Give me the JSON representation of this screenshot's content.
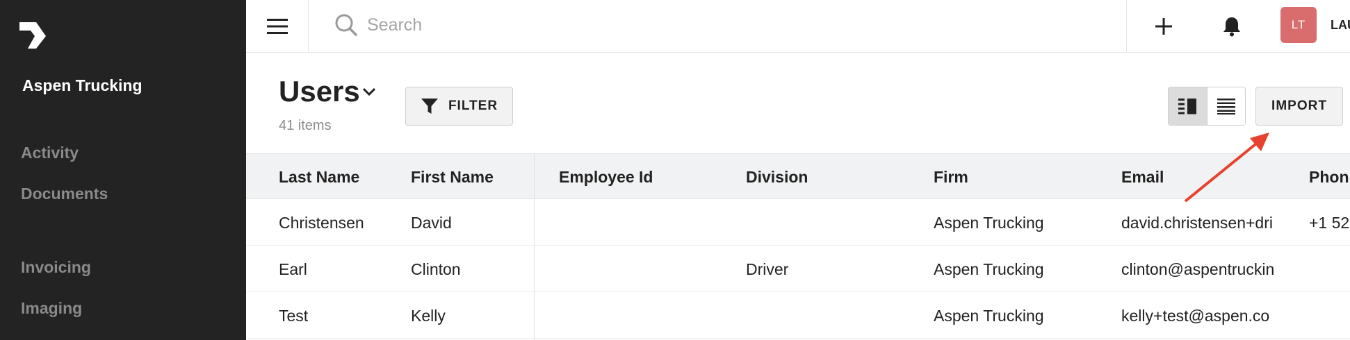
{
  "sidebar": {
    "company": "Aspen Trucking",
    "items": [
      {
        "label": "Activity"
      },
      {
        "label": "Documents"
      },
      {
        "label": "Invoicing"
      },
      {
        "label": "Imaging"
      }
    ]
  },
  "topbar": {
    "search_placeholder": "Search",
    "avatar_initials": "LT",
    "user_name": "LAU"
  },
  "page": {
    "title": "Users",
    "count": "41 items",
    "filter_label": "FILTER",
    "import_label": "IMPORT"
  },
  "table": {
    "columns": [
      "Last Name",
      "First Name",
      "Employee Id",
      "Division",
      "Firm",
      "Email",
      "Phon"
    ],
    "rows": [
      {
        "last": "Christensen",
        "first": "David",
        "employee_id": "",
        "division": "",
        "firm": "Aspen Trucking",
        "email": "david.christensen+dri",
        "phone": "+1 52"
      },
      {
        "last": "Earl",
        "first": "Clinton",
        "employee_id": "",
        "division": "Driver",
        "firm": "Aspen Trucking",
        "email": "clinton@aspentruckin",
        "phone": ""
      },
      {
        "last": "Test",
        "first": "Kelly",
        "employee_id": "",
        "division": "",
        "firm": "Aspen Trucking",
        "email": "kelly+test@aspen.co",
        "phone": ""
      }
    ]
  },
  "colors": {
    "sidebar_bg": "#232323",
    "avatar_bg": "#d96c6c",
    "annotation_arrow": "#e8422f",
    "header_bg": "#f1f2f3"
  },
  "icons": [
    "logo-icon",
    "hamburger-icon",
    "search-icon",
    "plus-icon",
    "bell-icon",
    "chevron-down-icon",
    "filter-icon",
    "split-view-icon",
    "list-view-icon"
  ]
}
